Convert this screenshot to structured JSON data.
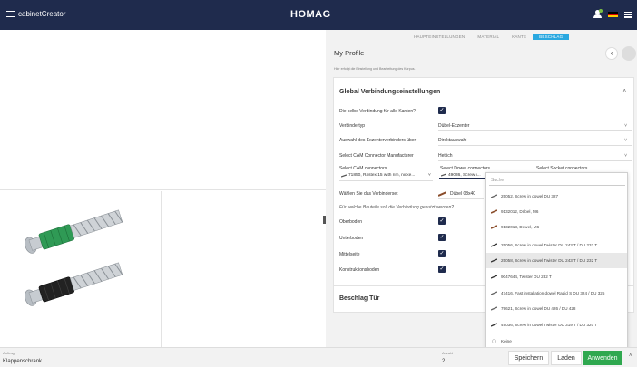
{
  "topbar": {
    "app_title": "cabinetCreator",
    "brand": "HOMAG"
  },
  "tabs": [
    {
      "label": "HAUPTEINSTELLUNGEN",
      "active": false
    },
    {
      "label": "MATERIAL",
      "active": false
    },
    {
      "label": "KANTE",
      "active": false
    },
    {
      "label": "BESCHLAG",
      "active": true
    }
  ],
  "profile": {
    "title": "My Profile",
    "subtitle": "Hier erfolgt die Einstellung und Bearbeitung des Korpus."
  },
  "global": {
    "title": "Global Verbindungseinstellungen",
    "same_connection_label": "Die selbe Verbindung für alle Kanten?",
    "connector_type_label": "Verbindertyp",
    "connector_type_value": "Dübel-Exzenter",
    "eccentric_label": "Auswahl des Exzenterverbinders über",
    "eccentric_value": "Direktauswahl",
    "cam_mfr_label": "Select CAM Connector Manufacturer",
    "cam_mfr_value": "Hettich",
    "cam_head": "Select CAM connectors",
    "cam_value": "71850, Rastex 15 with rim, nicke...",
    "dowel_head": "Select Dowel connectors",
    "dowel_value": "49036, Screw i...",
    "socket_head": "Select Socket connectors",
    "connector_set_label": "Wählen Sie das Verbinderset",
    "connector_set_value": "Dübel 08x40",
    "parts_question": "Für welche Bauteile soll die Verbindung genutzt werden?",
    "parts": [
      {
        "label": "Oberboden",
        "checked": true
      },
      {
        "label": "Unterboden",
        "checked": true
      },
      {
        "label": "Mittelseite",
        "checked": true
      },
      {
        "label": "Konstruktionsboden",
        "checked": true
      }
    ]
  },
  "door_fitting": {
    "title": "Beschlag Tür"
  },
  "dropdown": {
    "search_placeholder": "Suche",
    "items": [
      {
        "label": "25052, Screw in dowel DU 327",
        "highlighted": false
      },
      {
        "label": "9132012, Dübel, M6",
        "highlighted": false
      },
      {
        "label": "9132013, Dowel, M6",
        "highlighted": false
      },
      {
        "label": "25056, Screw in dowel Twister DU 243 T / DU 232 T",
        "highlighted": false
      },
      {
        "label": "25058, Screw in dowel Twister DU 243 T / DU 232 T",
        "highlighted": true
      },
      {
        "label": "9047644, Twister DU 232 T",
        "highlighted": false
      },
      {
        "label": "47416, Fast installation dowel Rapid S DU 324 / DU 325",
        "highlighted": false
      },
      {
        "label": "79621, Screw in dowel DU 426 / DU 428",
        "highlighted": false
      },
      {
        "label": "49036, Screw in dowel Twister DU 319 T / DU 320 T",
        "highlighted": false
      },
      {
        "label": "Keine",
        "highlighted": false
      }
    ]
  },
  "bottom": {
    "auftrag_label": "Auftrag",
    "auftrag_value": "Klappenschrank",
    "anzahl_label": "Anzahl",
    "anzahl_value": "2",
    "save": "Speichern",
    "load": "Laden",
    "apply": "Anwenden"
  },
  "colors": {
    "navy": "#1f2b4d",
    "accent": "#29a8e0",
    "green": "#2fa84f"
  }
}
